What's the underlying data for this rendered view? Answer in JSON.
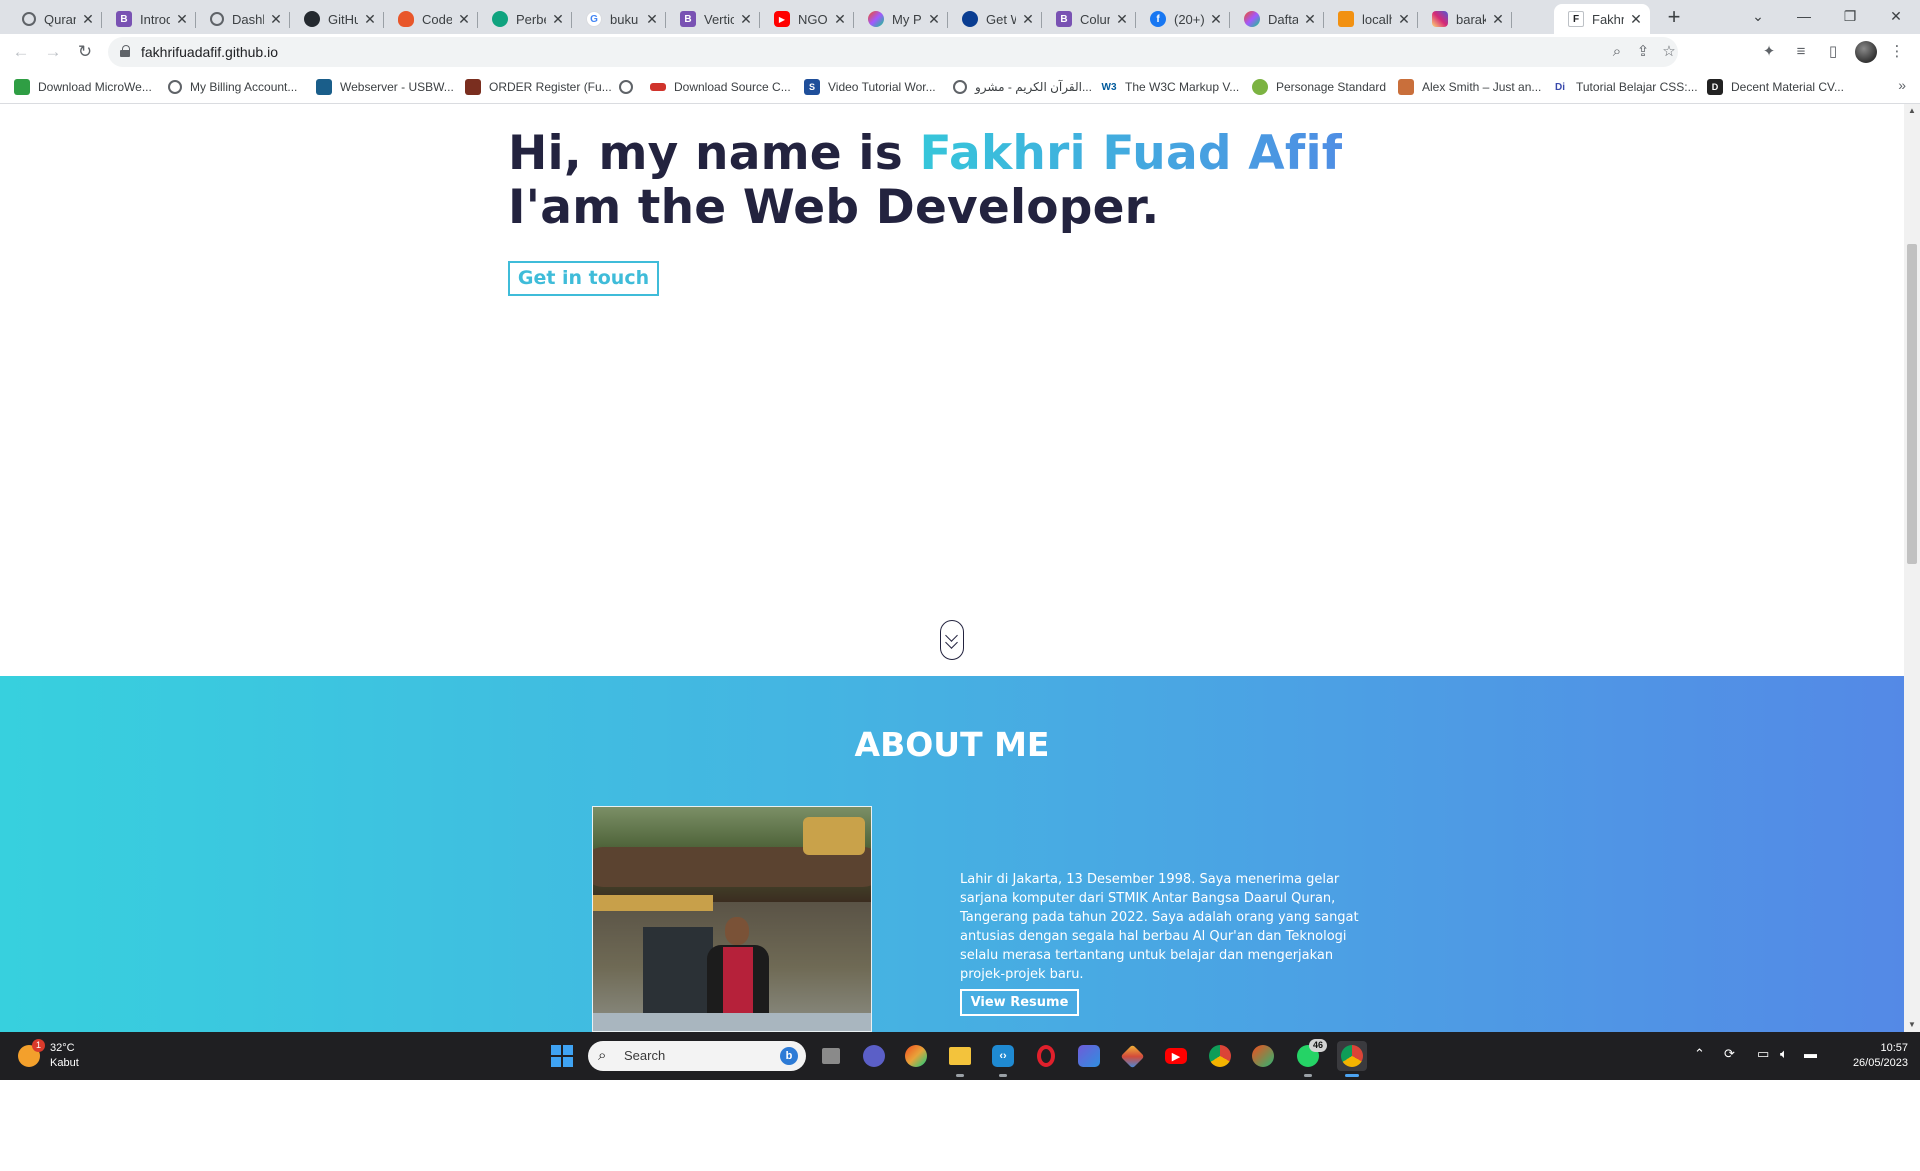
{
  "browser": {
    "tabs": [
      {
        "label": "Quran",
        "icon": "globe-icon",
        "color": "#5f6368"
      },
      {
        "label": "Introd",
        "icon": "bootstrap-icon",
        "color": "#7952b3"
      },
      {
        "label": "Dashb",
        "icon": "globe-icon",
        "color": "#5f6368"
      },
      {
        "label": "GitHu",
        "icon": "github-icon",
        "color": "#24292f"
      },
      {
        "label": "Codel",
        "icon": "fire-icon",
        "color": "#e8562a"
      },
      {
        "label": "Perbe",
        "icon": "chatgpt-icon",
        "color": "#10a37f"
      },
      {
        "label": "buku",
        "icon": "google-icon",
        "color": "#4285f4"
      },
      {
        "label": "Vertic",
        "icon": "bootstrap-icon",
        "color": "#7952b3"
      },
      {
        "label": "NGOB",
        "icon": "youtube-icon",
        "color": "#ff0000"
      },
      {
        "label": "My Po",
        "icon": "figma-icon",
        "color": "#a259ff"
      },
      {
        "label": "Get W",
        "icon": "edge-icon",
        "color": "#0a3d91"
      },
      {
        "label": "Colum",
        "icon": "bootstrap-icon",
        "color": "#7952b3"
      },
      {
        "label": "(20+)",
        "icon": "facebook-icon",
        "color": "#1877f2"
      },
      {
        "label": "Dafta",
        "icon": "figma-icon",
        "color": "#a259ff"
      },
      {
        "label": "localh",
        "icon": "phpmyadmin-icon",
        "color": "#f29111"
      },
      {
        "label": "barak",
        "icon": "instagram-icon",
        "color": "#d62976"
      },
      {
        "label": "Fakhri",
        "icon": "f-letter-icon",
        "color": "#ffffff"
      }
    ],
    "address": "fakhrifuadafif.github.io",
    "bookmarks": [
      {
        "label": "Download MicroWe...",
        "color": "#2f9e44"
      },
      {
        "label": "My Billing Account...",
        "color": "#5f6368"
      },
      {
        "label": "Webserver - USBW...",
        "color": "#1a5e8a"
      },
      {
        "label": "ORDER Register (Fu...",
        "color": "#7a2e1f"
      },
      {
        "label": "",
        "color": "#5f6368"
      },
      {
        "label": "Download Source C...",
        "color": "#d0342c"
      },
      {
        "label": "Video Tutorial Wor...",
        "color": "#1f4f9a"
      },
      {
        "label": "القرآن الكريم - مشرو...",
        "color": "#5f6368"
      },
      {
        "label": "The W3C Markup V...",
        "color": "#005a9c"
      },
      {
        "label": "Personage Standard",
        "color": "#7cb342"
      },
      {
        "label": "Alex Smith – Just an...",
        "color": "#c96f3b"
      },
      {
        "label": "Tutorial Belajar CSS:...",
        "color": "#3949ab"
      },
      {
        "label": "Decent Material CV...",
        "color": "#222222"
      }
    ],
    "more_bookmarks": "»"
  },
  "page": {
    "hero_line1_prefix": "Hi, my name is ",
    "hero_name": "Fakhri Fuad Afif",
    "hero_line2": "I'am the Web Developer.",
    "cta_label": "Get in touch",
    "about_title": "ABOUT ME",
    "about_text": "Lahir di Jakarta, 13 Desember 1998. Saya menerima gelar sarjana komputer dari STMIK Antar Bangsa Daarul Quran, Tangerang pada tahun 2022. Saya adalah orang yang sangat antusias dengan segala hal berbau Al Qur'an dan Teknologi selalu merasa tertantang untuk belajar dan mengerjakan projek-projek baru.",
    "resume_label": "View Resume",
    "colors": {
      "dark": "#23233f",
      "accent_start": "#36c6da",
      "accent_end": "#4f8ee4"
    }
  },
  "taskbar": {
    "weather_temp": "32°C",
    "weather_desc": "Kabut",
    "weather_badge": "1",
    "search_placeholder": "Search",
    "apps": [
      {
        "name": "task-view-icon",
        "color": "#8a8a8a"
      },
      {
        "name": "teams-icon",
        "color": "#5b5fc7"
      },
      {
        "name": "figma-app-icon",
        "color": "#e8a33a"
      },
      {
        "name": "file-explorer-icon",
        "color": "#f3c33c"
      },
      {
        "name": "vscode-icon",
        "color": "#1f8ad2"
      },
      {
        "name": "opera-icon",
        "color": "#e0202c"
      },
      {
        "name": "power-automate-icon",
        "color": "#6f5bd8"
      },
      {
        "name": "git-icon",
        "color": "#f2bb38"
      },
      {
        "name": "youtube-app-icon",
        "color": "#ff0000"
      },
      {
        "name": "chrome-app-icon",
        "color": "#e5a735"
      },
      {
        "name": "figma-app-icon-2",
        "color": "#2bb673"
      },
      {
        "name": "whatsapp-icon",
        "color": "#25d366"
      },
      {
        "name": "chrome-active-icon",
        "color": "#e5a735"
      }
    ],
    "whatsapp_badge": "46",
    "time": "10:57",
    "date": "26/05/2023"
  }
}
